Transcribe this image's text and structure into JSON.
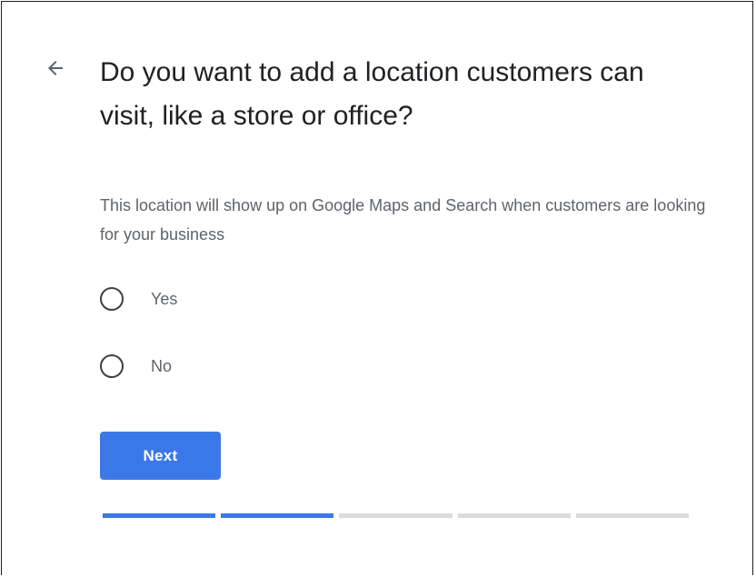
{
  "header": {
    "back_icon": "arrow-left-icon",
    "title": "Do you want to add a location customers can visit, like a store or office?",
    "subtitle": "This location will show up on Google Maps and Search when customers are looking for your business"
  },
  "options": [
    {
      "label": "Yes",
      "selected": false
    },
    {
      "label": "No",
      "selected": false
    }
  ],
  "actions": {
    "next_label": "Next"
  },
  "progress": {
    "total_steps": 5,
    "completed_steps": 2
  },
  "colors": {
    "accent": "#3b78e7",
    "track": "#dadce0",
    "title_text": "#202124",
    "secondary_text": "#5f6368"
  }
}
